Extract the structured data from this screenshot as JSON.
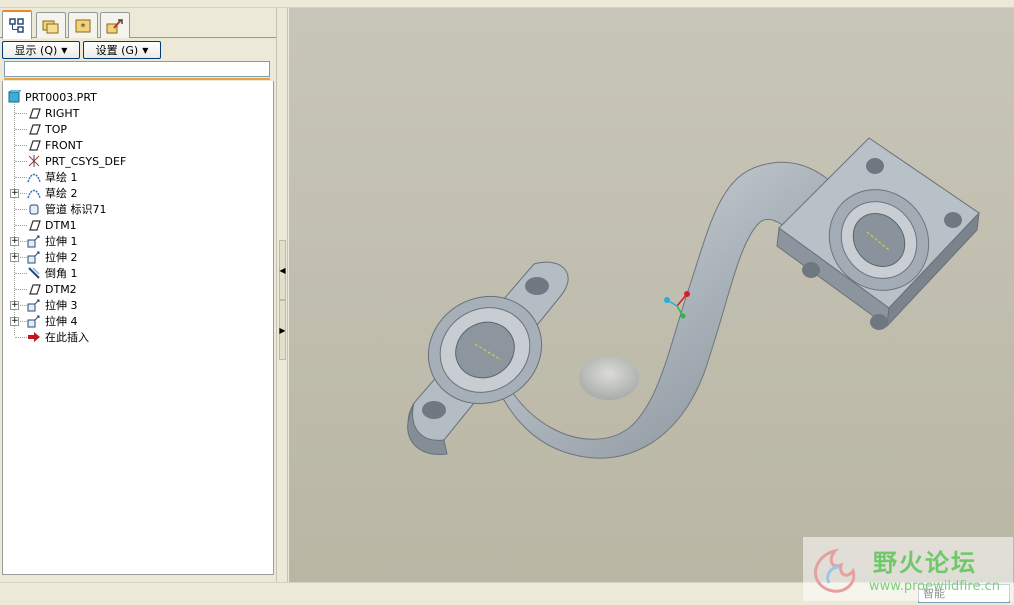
{
  "left_panel": {
    "tabs": [
      {
        "icon": "model-tree-icon",
        "active": true
      },
      {
        "icon": "folder-browser-icon",
        "active": false
      },
      {
        "icon": "favorites-icon",
        "active": false
      },
      {
        "icon": "connections-icon",
        "active": false
      }
    ],
    "buttons": {
      "show_label": "显示 (Q)",
      "settings_label": "设置 (G)"
    },
    "search": {
      "value": ""
    },
    "tree": [
      {
        "label": "PRT0003.PRT",
        "icon": "part-icon",
        "expandable": false
      },
      {
        "label": "RIGHT",
        "icon": "datum-plane-icon",
        "expandable": false
      },
      {
        "label": "TOP",
        "icon": "datum-plane-icon",
        "expandable": false
      },
      {
        "label": "FRONT",
        "icon": "datum-plane-icon",
        "expandable": false
      },
      {
        "label": "PRT_CSYS_DEF",
        "icon": "csys-icon",
        "expandable": false
      },
      {
        "label": "草绘 1",
        "icon": "sketch-icon",
        "expandable": false
      },
      {
        "label": "草绘 2",
        "icon": "sketch-icon",
        "expandable": true
      },
      {
        "label": "管道 标识71",
        "icon": "pipe-icon",
        "expandable": false
      },
      {
        "label": "DTM1",
        "icon": "datum-plane-icon",
        "expandable": false
      },
      {
        "label": "拉伸 1",
        "icon": "extrude-icon",
        "expandable": true
      },
      {
        "label": "拉伸 2",
        "icon": "extrude-icon",
        "expandable": true
      },
      {
        "label": "倒角 1",
        "icon": "chamfer-icon",
        "expandable": false
      },
      {
        "label": "DTM2",
        "icon": "datum-plane-icon",
        "expandable": false
      },
      {
        "label": "拉伸 3",
        "icon": "extrude-icon",
        "expandable": true
      },
      {
        "label": "拉伸 4",
        "icon": "extrude-icon",
        "expandable": true
      },
      {
        "label": "在此插入",
        "icon": "insert-here-arrow-icon",
        "expandable": false
      }
    ]
  },
  "status": {
    "filter_value": "智能"
  },
  "watermark": {
    "title": "野火论坛",
    "url": "www.proewildfire.cn"
  },
  "colors": {
    "accent": "#e8a33d",
    "part_icon": "#3aaed8",
    "model_fill": "#a7b0b8"
  }
}
